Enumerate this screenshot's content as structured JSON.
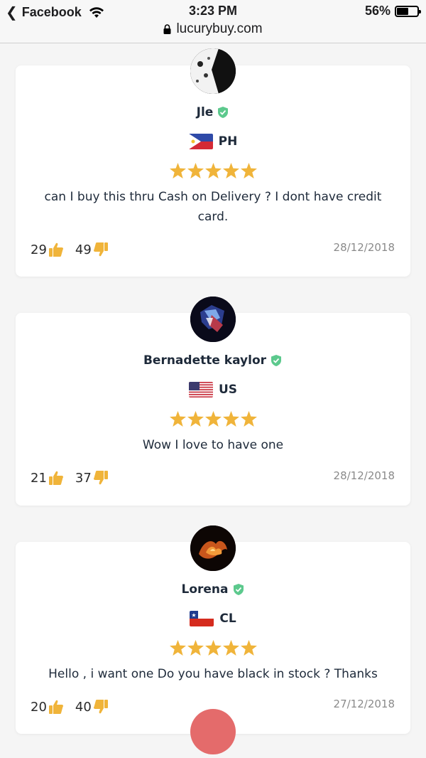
{
  "status_bar": {
    "back_app": "Facebook",
    "time": "3:23 PM",
    "battery": "56%",
    "battery_level": 0.56
  },
  "browser": {
    "url": "lucurybuy.com"
  },
  "reviews": [
    {
      "name": "Jle",
      "country": "PH",
      "rating": 5,
      "text": "can I buy this thru Cash on Delivery ? I dont have credit card.",
      "likes": "29",
      "dislikes": "49",
      "date": "28/12/2018"
    },
    {
      "name": "Bernadette kaylor",
      "country": "US",
      "rating": 5,
      "text": "Wow I love to have one",
      "likes": "21",
      "dislikes": "37",
      "date": "28/12/2018"
    },
    {
      "name": "Lorena",
      "country": "CL",
      "rating": 5,
      "text": "Hello , i want one Do you have black in stock ? Thanks",
      "likes": "20",
      "dislikes": "40",
      "date": "27/12/2018"
    }
  ],
  "colors": {
    "star": "#f0b43a",
    "thumb": "#f0b43a",
    "verified": "#5cc98d",
    "text": "#1e2a3a"
  }
}
